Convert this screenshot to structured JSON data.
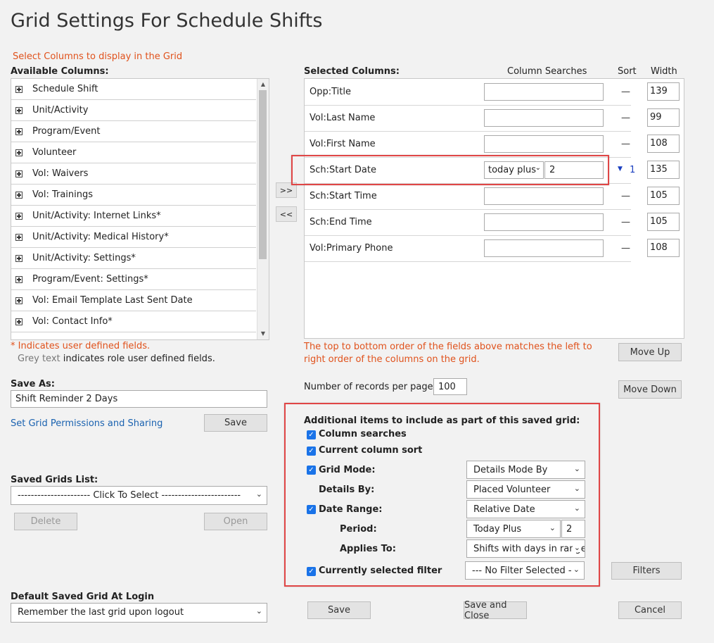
{
  "title": "Grid Settings For Schedule Shifts",
  "instructions": "Select Columns to display in the Grid",
  "available": {
    "label": "Available Columns:",
    "items": [
      "Schedule Shift",
      "Unit/Activity",
      "Program/Event",
      "Volunteer",
      "Vol: Waivers",
      "Vol: Trainings",
      "Unit/Activity: Internet Links*",
      "Unit/Activity: Medical History*",
      "Unit/Activity: Settings*",
      "Program/Event: Settings*",
      "Vol: Email Template Last Sent Date",
      "Vol: Contact Info*"
    ]
  },
  "move_buttons": {
    "add": ">>",
    "remove": "<<"
  },
  "selected": {
    "label": "Selected Columns:",
    "col_searches": "Column Searches",
    "col_sort": "Sort",
    "col_width": "Width",
    "rows": [
      {
        "name": "Opp:Title",
        "sort": "—",
        "width": "139"
      },
      {
        "name": "Vol:Last Name",
        "sort": "—",
        "width": "99"
      },
      {
        "name": "Vol:First Name",
        "sort": "—",
        "width": "108"
      },
      {
        "name": "Sch:Start Date",
        "search_select": "today plus",
        "search_value": "2",
        "sort_num": "1",
        "width": "135"
      },
      {
        "name": "Sch:Start Time",
        "sort": "—",
        "width": "105"
      },
      {
        "name": "Sch:End Time",
        "sort": "—",
        "width": "105"
      },
      {
        "name": "Vol:Primary Phone",
        "sort": "—",
        "width": "108"
      }
    ]
  },
  "notes": {
    "user_defined": "* Indicates user defined fields.",
    "grey_text": "Grey text",
    "role_defined": " indicates role user defined fields.",
    "order_note": "The top to bottom order of the fields above matches the left to right order of the columns on the grid."
  },
  "move_up": "Move Up",
  "move_down": "Move Down",
  "records_per_page": {
    "label": "Number of records per page:",
    "value": "100"
  },
  "save_as": {
    "label": "Save As:",
    "value": "Shift Reminder 2 Days"
  },
  "permissions_link": "Set Grid Permissions and Sharing",
  "save_label": "Save",
  "saved_grids": {
    "label": "Saved Grids List:",
    "value": "---------------------- Click To Select ------------------------"
  },
  "delete_label": "Delete",
  "open_label": "Open",
  "default_grid": {
    "label": "Default Saved Grid At Login",
    "value": "Remember the last grid upon logout"
  },
  "additional": {
    "heading": "Additional items to include as part of this saved grid:",
    "column_searches": "Column searches",
    "current_sort": "Current column sort",
    "grid_mode": "Grid Mode:",
    "grid_mode_value": "Details Mode By",
    "details_by": "Details By:",
    "details_by_value": "Placed Volunteer",
    "date_range": "Date Range:",
    "date_range_value": "Relative Date",
    "period": "Period:",
    "period_value": "Today Plus",
    "period_num": "2",
    "applies_to": "Applies To:",
    "applies_to_value": "Shifts with days in range",
    "current_filter": "Currently selected filter",
    "filter_value": "--- No Filter Selected ---"
  },
  "filters_label": "Filters",
  "bottom": {
    "save": "Save",
    "save_close": "Save and Close",
    "cancel": "Cancel"
  },
  "colors": {
    "accent_orange": "#e0521c",
    "highlight_red": "#e04646",
    "link_blue": "#1a62b0",
    "checkbox_blue": "#1a73e8"
  }
}
